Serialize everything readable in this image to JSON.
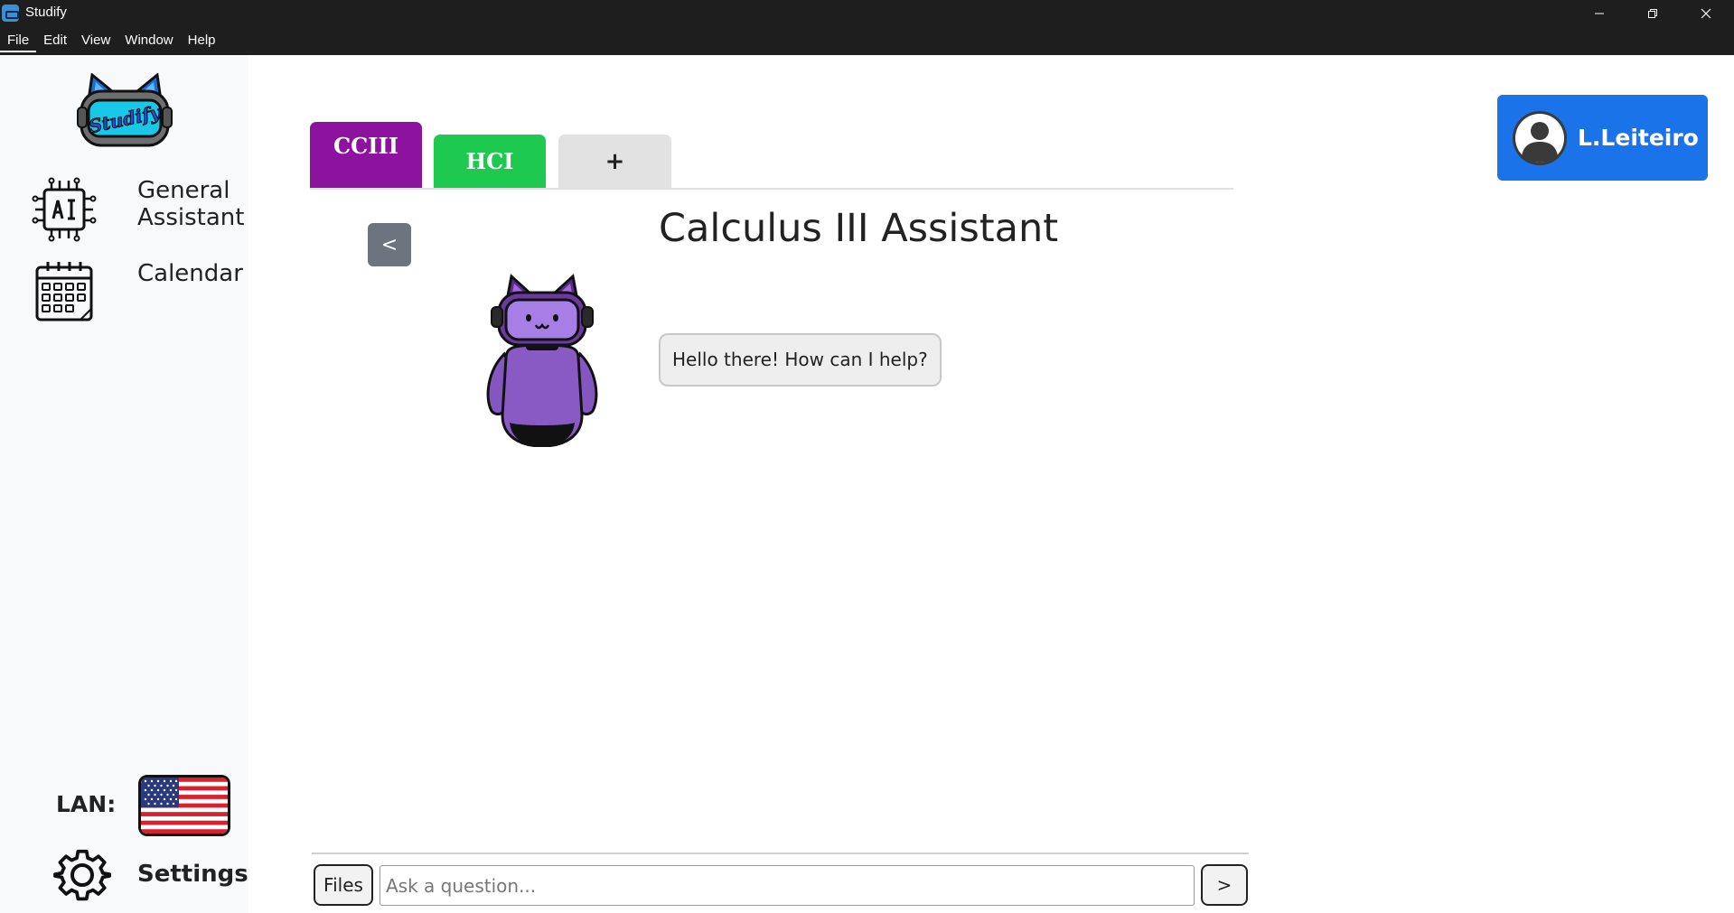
{
  "window": {
    "title": "Studify",
    "icon": "studify-app-icon",
    "controls": [
      "minimize-icon",
      "maximize-icon",
      "close-icon"
    ]
  },
  "menubar": {
    "items": [
      {
        "label": "File"
      },
      {
        "label": "Edit"
      },
      {
        "label": "View"
      },
      {
        "label": "Window"
      },
      {
        "label": "Help"
      }
    ]
  },
  "sidebar": {
    "logo_text": "Studify",
    "nav": [
      {
        "label": "General Assistant",
        "icon": "ai-chip-icon"
      },
      {
        "label": "Calendar",
        "icon": "calendar-icon"
      }
    ],
    "language": {
      "label": "LAN:",
      "flag": "us-flag-icon"
    },
    "settings": {
      "label": "Settings",
      "icon": "gear-icon"
    }
  },
  "tabs": [
    {
      "label": "CCIII",
      "color": "#8b139e",
      "active": true
    },
    {
      "label": "HCI",
      "color": "#1ec94f",
      "active": false
    },
    {
      "label": "+",
      "color": "#e2e2e2",
      "active": false
    }
  ],
  "main": {
    "back_label": "<",
    "title": "Calculus III Assistant",
    "greeting": "Hello there! How can I help?",
    "mascot": "purple-cat-robot-mascot"
  },
  "user": {
    "name": "L.Leiteiro",
    "color": "#1a73e8"
  },
  "composer": {
    "files_label": "Files",
    "placeholder": "Ask a question...",
    "value": "",
    "send_label": ">"
  }
}
